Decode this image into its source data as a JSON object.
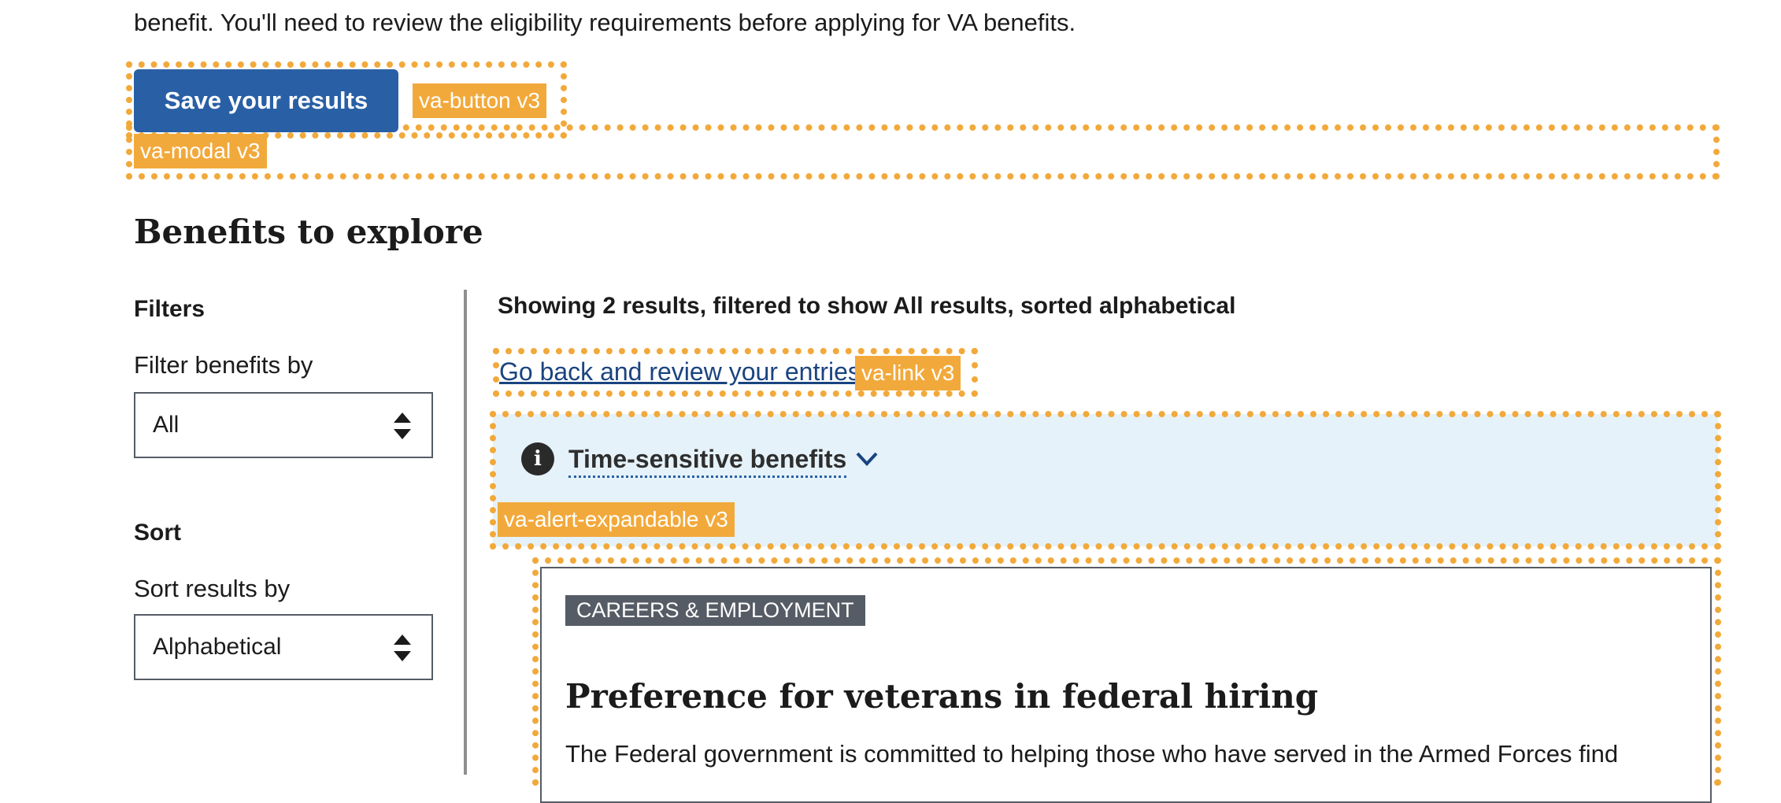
{
  "intro_text": "benefit. You'll need to review the eligibility requirements before applying for VA benefits.",
  "save_button": {
    "label": "Save your results"
  },
  "component_tags": {
    "button": "va-button v3",
    "modal": "va-modal v3",
    "link": "va-link v3",
    "alert": "va-alert-expandable v3"
  },
  "section_title": "Benefits to explore",
  "filters": {
    "heading": "Filters",
    "filter_label": "Filter benefits by",
    "filter_value": "All",
    "sort_heading": "Sort",
    "sort_label": "Sort results by",
    "sort_value": "Alphabetical"
  },
  "results": {
    "summary": "Showing 2 results, filtered to show All results, sorted alphabetical",
    "back_link": "Go back and review your entries",
    "alert_title": "Time-sensitive benefits"
  },
  "card": {
    "category": "CAREERS & EMPLOYMENT",
    "title": "Preference for veterans in federal hiring",
    "description": "The Federal government is committed to helping those who have served in the Armed Forces find"
  },
  "colors": {
    "primary_button": "#2960a5",
    "link": "#1a4480",
    "debug_outline": "#f2a93b",
    "alert_background": "#e5f2f9",
    "badge_background": "#565c65"
  },
  "icons": [
    "select-arrows-icon",
    "info-icon",
    "chevron-down-icon"
  ]
}
